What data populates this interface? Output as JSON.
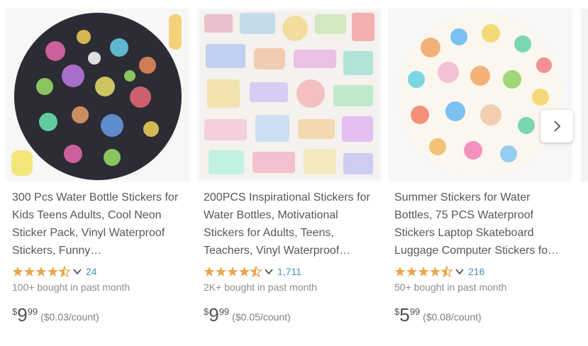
{
  "products": [
    {
      "title": "300 Pcs Water Bottle Stickers for Kids Teens Adults, Cool Neon Sticker Pack, Vinyl Waterproof Stickers, Funny…",
      "rating": 4.5,
      "rating_count": "24",
      "bought": "100+ bought in past month",
      "price": {
        "symbol": "$",
        "whole": "9",
        "fraction": "99",
        "unit": "($0.03/count)"
      }
    },
    {
      "title": "200PCS Inspirational Stickers for Water Bottles, Motivational Stickers for Adults, Teens, Teachers, Vinyl Waterproof…",
      "rating": 4.5,
      "rating_count": "1,711",
      "bought": "2K+ bought in past month",
      "price": {
        "symbol": "$",
        "whole": "9",
        "fraction": "99",
        "unit": "($0.05/count)"
      }
    },
    {
      "title": "Summer Stickers for Water Bottles, 75 PCS Waterproof Stickers Laptop Skateboard Luggage Computer Stickers fo…",
      "rating": 4.5,
      "rating_count": "216",
      "bought": "50+ bought in past month",
      "price": {
        "symbol": "$",
        "whole": "5",
        "fraction": "99",
        "unit": "($0.08/count)"
      }
    }
  ],
  "next_icon": "chevron-right-icon",
  "colors": {
    "star": "#e8a64c",
    "link": "#4a90b8",
    "text": "#565959"
  }
}
